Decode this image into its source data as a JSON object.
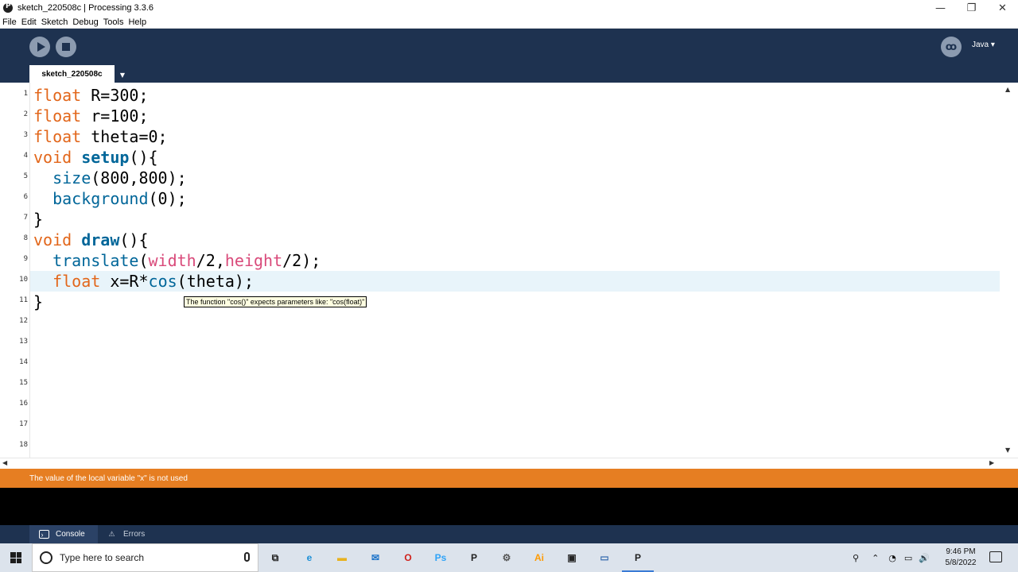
{
  "window": {
    "title": "sketch_220508c | Processing 3.3.6",
    "minimize": "—",
    "maximize": "❐",
    "close": "✕"
  },
  "menu": [
    "File",
    "Edit",
    "Sketch",
    "Debug",
    "Tools",
    "Help"
  ],
  "toolbar": {
    "mode_label": "Java ▾",
    "debug_glyph": "ꝏ"
  },
  "tabs": {
    "active": "sketch_220508c",
    "menu_glyph": "▼"
  },
  "editor": {
    "line_numbers": [
      "1",
      "2",
      "3",
      "4",
      "5",
      "6",
      "7",
      "8",
      "9",
      "10",
      "11",
      "12",
      "13",
      "14",
      "15",
      "16",
      "17",
      "18"
    ],
    "lines": [
      [
        {
          "t": "float",
          "c": "kw"
        },
        {
          "t": " R=300;",
          "c": ""
        }
      ],
      [
        {
          "t": "float",
          "c": "kw"
        },
        {
          "t": " r=100;",
          "c": ""
        }
      ],
      [
        {
          "t": "float",
          "c": "kw"
        },
        {
          "t": " theta=0;",
          "c": ""
        }
      ],
      [
        {
          "t": "void",
          "c": "kw"
        },
        {
          "t": " ",
          "c": ""
        },
        {
          "t": "setup",
          "c": "fn"
        },
        {
          "t": "(){",
          "c": ""
        }
      ],
      [
        {
          "t": "  ",
          "c": ""
        },
        {
          "t": "size",
          "c": "bi"
        },
        {
          "t": "(800,800);",
          "c": ""
        }
      ],
      [
        {
          "t": "  ",
          "c": ""
        },
        {
          "t": "background",
          "c": "bi"
        },
        {
          "t": "(0);",
          "c": ""
        }
      ],
      [
        {
          "t": "}",
          "c": ""
        }
      ],
      [
        {
          "t": "void",
          "c": "kw"
        },
        {
          "t": " ",
          "c": ""
        },
        {
          "t": "draw",
          "c": "fn"
        },
        {
          "t": "(){",
          "c": ""
        }
      ],
      [
        {
          "t": "  ",
          "c": ""
        },
        {
          "t": "translate",
          "c": "bi"
        },
        {
          "t": "(",
          "c": ""
        },
        {
          "t": "width",
          "c": "var"
        },
        {
          "t": "/2,",
          "c": ""
        },
        {
          "t": "height",
          "c": "var"
        },
        {
          "t": "/2);",
          "c": ""
        }
      ],
      [
        {
          "t": "  ",
          "c": ""
        },
        {
          "t": "float",
          "c": "kw"
        },
        {
          "t": " x=R*",
          "c": ""
        },
        {
          "t": "cos",
          "c": "bi"
        },
        {
          "t": "(theta);",
          "c": ""
        }
      ],
      [
        {
          "t": "}",
          "c": ""
        }
      ]
    ],
    "tooltip": "The function \"cos()\" expects parameters like: \"cos(float)\""
  },
  "status": {
    "message": "The value of the local variable \"x\" is not used"
  },
  "console_tabs": {
    "console": "Console",
    "errors": "Errors"
  },
  "taskbar": {
    "search_placeholder": "Type here to search",
    "time": "9:46 PM",
    "date": "5/8/2022",
    "apps": [
      {
        "name": "task-view-icon",
        "glyph": "⧉",
        "color": "#222222"
      },
      {
        "name": "edge-icon",
        "glyph": "e",
        "color": "#1c8fd6"
      },
      {
        "name": "file-explorer-icon",
        "glyph": "▬",
        "color": "#e8b21f"
      },
      {
        "name": "mail-icon",
        "glyph": "✉",
        "color": "#1c73c9"
      },
      {
        "name": "opera-icon",
        "glyph": "O",
        "color": "#d0211b"
      },
      {
        "name": "photoshop-icon",
        "glyph": "Ps",
        "color": "#2fa3f7"
      },
      {
        "name": "processing-icon",
        "glyph": "P",
        "color": "#222222"
      },
      {
        "name": "settings-app-icon",
        "glyph": "⚙",
        "color": "#555555"
      },
      {
        "name": "illustrator-icon",
        "glyph": "Ai",
        "color": "#ff9a00"
      },
      {
        "name": "store-icon",
        "glyph": "▣",
        "color": "#222222"
      },
      {
        "name": "app-window-icon",
        "glyph": "▭",
        "color": "#3a6fb0"
      },
      {
        "name": "processing-active-icon",
        "glyph": "P",
        "color": "#222222"
      }
    ],
    "tray": [
      "⚲",
      "⌃",
      "◔",
      "▭",
      "🔊"
    ]
  }
}
